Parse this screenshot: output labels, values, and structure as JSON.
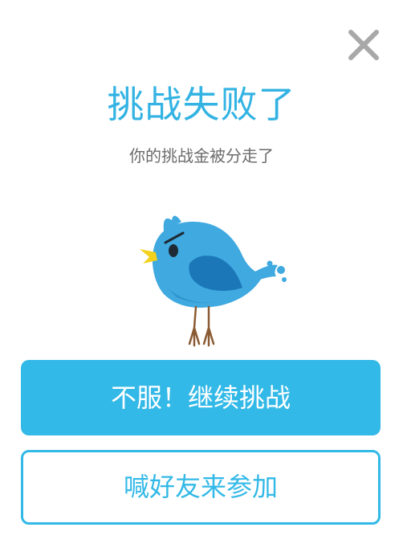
{
  "dialog": {
    "title": "挑战失败了",
    "subtitle": "你的挑战金被分走了",
    "close_icon": "close-icon",
    "illustration": "angry-bird-icon",
    "retry_button_label": "不服！继续挑战",
    "invite_button_label": "喊好友来参加"
  },
  "colors": {
    "accent": "#33b9e7",
    "title": "#33b3e3",
    "subtitle": "#6b6b6b",
    "close": "#a8a8a8",
    "bird_body": "#3fa9e0",
    "bird_wing": "#1b77b8",
    "beak": "#f3d21d",
    "legs": "#8a5a32"
  }
}
